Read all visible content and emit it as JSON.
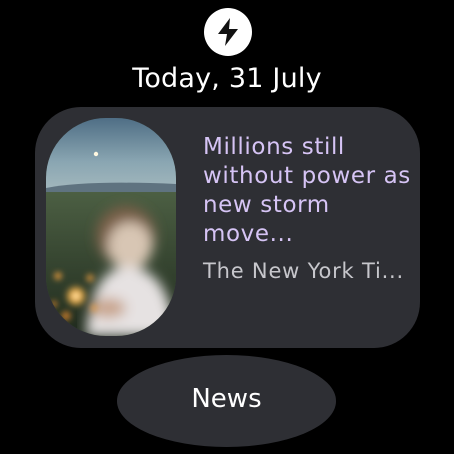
{
  "header": {
    "icon": "bolt-icon",
    "date": "Today, 31 July"
  },
  "article": {
    "image": "news-thumbnail",
    "headline": "Millions still\nwithout power as\nnew storm move...",
    "source": "The New York Ti..."
  },
  "footer": {
    "button_label": "News"
  },
  "colors": {
    "background": "#000000",
    "surface": "#2e2f34",
    "headline": "#d6c4f5",
    "secondary_text": "#c7c7cc",
    "icon_background": "#ffffff"
  }
}
